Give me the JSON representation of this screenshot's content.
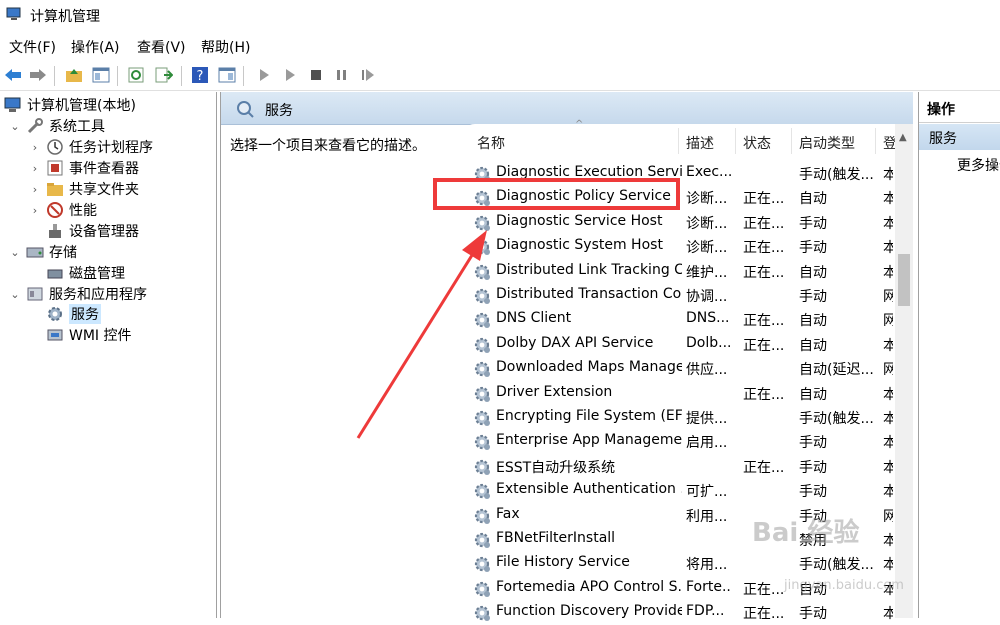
{
  "window": {
    "title": "计算机管理"
  },
  "menu": [
    "文件(F)",
    "操作(A)",
    "查看(V)",
    "帮助(H)"
  ],
  "tree": [
    {
      "label": "计算机管理(本地)",
      "level": 0,
      "expander": "",
      "icon": "computer-icon"
    },
    {
      "label": "系统工具",
      "level": 1,
      "expander": "⌄",
      "icon": "tools-icon"
    },
    {
      "label": "任务计划程序",
      "level": 2,
      "expander": "›",
      "icon": "clock-icon"
    },
    {
      "label": "事件查看器",
      "level": 2,
      "expander": "›",
      "icon": "event-icon"
    },
    {
      "label": "共享文件夹",
      "level": 2,
      "expander": "›",
      "icon": "folder-icon"
    },
    {
      "label": "性能",
      "level": 2,
      "expander": "›",
      "icon": "performance-icon"
    },
    {
      "label": "设备管理器",
      "level": 2,
      "expander": "",
      "icon": "device-icon"
    },
    {
      "label": "存储",
      "level": 1,
      "expander": "⌄",
      "icon": "storage-icon"
    },
    {
      "label": "磁盘管理",
      "level": 2,
      "expander": "",
      "icon": "disk-icon"
    },
    {
      "label": "服务和应用程序",
      "level": 1,
      "expander": "⌄",
      "icon": "apps-icon"
    },
    {
      "label": "服务",
      "level": 2,
      "expander": "",
      "icon": "gear-icon",
      "selected": true
    },
    {
      "label": "WMI 控件",
      "level": 2,
      "expander": "",
      "icon": "wmi-icon"
    }
  ],
  "services_panel": {
    "header": "服务",
    "description_prompt": "选择一个项目来查看它的描述。",
    "columns": [
      "名称",
      "描述",
      "状态",
      "启动类型",
      "登"
    ],
    "rows": [
      [
        "Diagnostic Execution Service",
        "Exec...",
        "",
        "手动(触发...",
        "本"
      ],
      [
        "Diagnostic Policy Service",
        "诊断...",
        "正在...",
        "自动",
        "本"
      ],
      [
        "Diagnostic Service Host",
        "诊断...",
        "正在...",
        "手动",
        "本"
      ],
      [
        "Diagnostic System Host",
        "诊断...",
        "正在...",
        "手动",
        "本"
      ],
      [
        "Distributed Link Tracking C...",
        "维护...",
        "正在...",
        "自动",
        "本"
      ],
      [
        "Distributed Transaction Co...",
        "协调...",
        "",
        "手动",
        "网"
      ],
      [
        "DNS Client",
        "DNS...",
        "正在...",
        "自动",
        "网"
      ],
      [
        "Dolby DAX API Service",
        "Dolb...",
        "正在...",
        "自动",
        "本"
      ],
      [
        "Downloaded Maps Manager",
        "供应...",
        "",
        "自动(延迟...",
        "网"
      ],
      [
        "Driver Extension",
        "",
        "正在...",
        "自动",
        "本"
      ],
      [
        "Encrypting File System (EFS)",
        "提供...",
        "",
        "手动(触发...",
        "本"
      ],
      [
        "Enterprise App Manageme...",
        "启用...",
        "",
        "手动",
        "本"
      ],
      [
        "ESST自动升级系统",
        "",
        "正在...",
        "手动",
        "本"
      ],
      [
        "Extensible Authentication ...",
        "可扩...",
        "",
        "手动",
        "本"
      ],
      [
        "Fax",
        "利用...",
        "",
        "手动",
        "网"
      ],
      [
        "FBNetFilterInstall",
        "",
        "",
        "禁用",
        "本"
      ],
      [
        "File History Service",
        "将用...",
        "",
        "手动(触发...",
        "本"
      ],
      [
        "Fortemedia APO Control S...",
        "Forte...",
        "正在...",
        "自动",
        "本"
      ],
      [
        "Function Discovery Provide...",
        "FDP...",
        "正在...",
        "手动",
        "本"
      ]
    ]
  },
  "actions": {
    "header": "操作",
    "selected": "服务",
    "more": "更多操作"
  },
  "watermark": {
    "brand": "Bai 经验",
    "url": "jingyan.baidu.com"
  },
  "colors": {
    "highlight": "#ee3a3a",
    "selection": "#cce8ff",
    "panel_header": "#c6d9ec"
  }
}
